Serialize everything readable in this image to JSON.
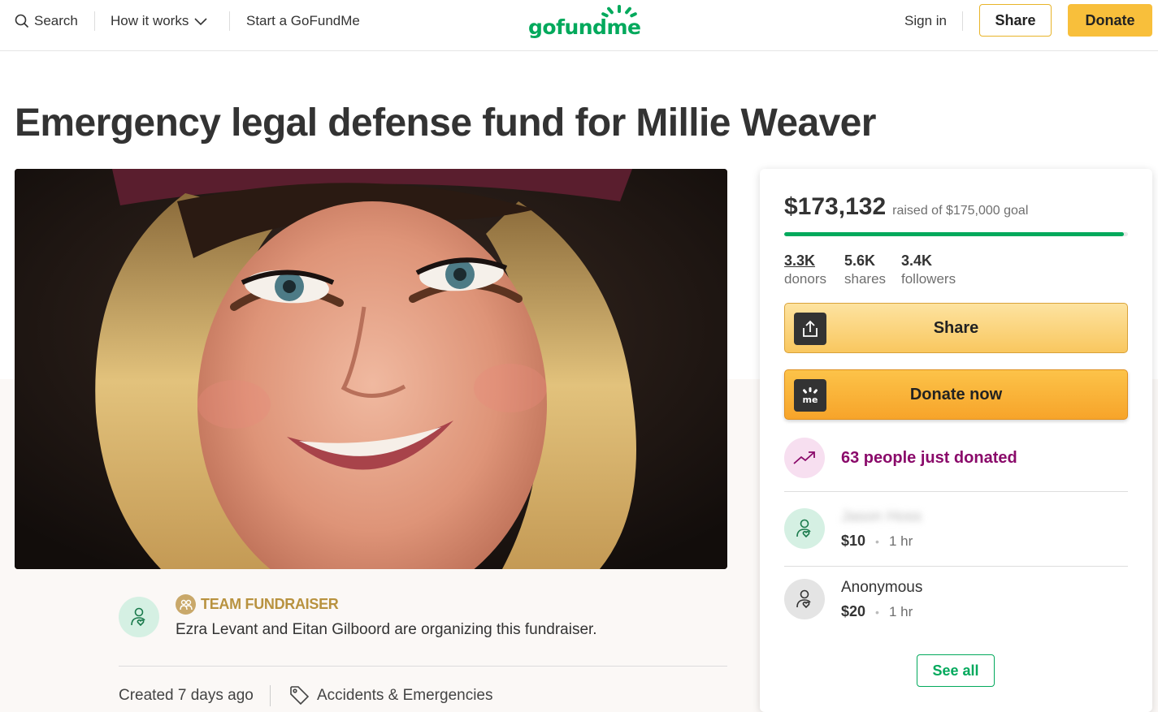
{
  "header": {
    "search_label": "Search",
    "how_it_works_label": "How it works",
    "start_label": "Start a GoFundMe",
    "logo_text": "gofundme",
    "sign_in_label": "Sign in",
    "share_label": "Share",
    "donate_label": "Donate"
  },
  "campaign": {
    "title": "Emergency legal defense fund for Millie Weaver",
    "organizer": {
      "badge": "TEAM FUNDRAISER",
      "text": "Ezra Levant and Eitan Gilboord are organizing this fundraiser."
    },
    "created": "Created 7 days ago",
    "category": "Accidents & Emergencies"
  },
  "donation_card": {
    "raised": "$173,132",
    "goal_text": "raised of $175,000 goal",
    "progress_fraction": 0.989,
    "stats": [
      {
        "value": "3.3K",
        "label": "donors"
      },
      {
        "value": "5.6K",
        "label": "shares"
      },
      {
        "value": "3.4K",
        "label": "followers"
      }
    ],
    "share_button": "Share",
    "donate_button": "Donate now",
    "just_donated": "63 people just donated",
    "donations": [
      {
        "name": "Jason Hoss",
        "amount": "$10",
        "time": "1 hr",
        "avatar": "heart-hand-icon"
      },
      {
        "name": "Anonymous",
        "amount": "$20",
        "time": "1 hr",
        "avatar": "heart-hand-icon"
      }
    ],
    "see_all": "See all"
  },
  "colors": {
    "brand_green": "#02a95c",
    "accent_yellow": "#f8bf3b",
    "trend_purple": "#8a0a6a",
    "team_gold": "#b8923f"
  }
}
